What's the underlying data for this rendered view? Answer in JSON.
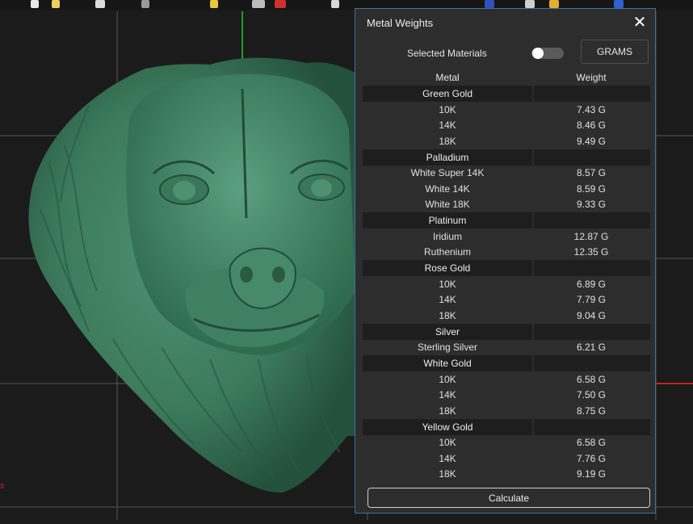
{
  "panel": {
    "title": "Metal Weights",
    "selected_materials_label": "Selected Materials",
    "units_button": "GRAMS",
    "calculate_button": "Calculate",
    "columns": [
      "Metal",
      "Weight"
    ],
    "groups": [
      {
        "name": "Green Gold",
        "items": [
          {
            "metal": "10K",
            "weight": "7.43 G"
          },
          {
            "metal": "14K",
            "weight": "8.46 G"
          },
          {
            "metal": "18K",
            "weight": "9.49 G"
          }
        ]
      },
      {
        "name": "Palladium",
        "items": [
          {
            "metal": "White Super 14K",
            "weight": "8.57 G"
          },
          {
            "metal": "White 14K",
            "weight": "8.59 G"
          },
          {
            "metal": "White 18K",
            "weight": "9.33 G"
          }
        ]
      },
      {
        "name": "Platinum",
        "items": [
          {
            "metal": "Iridium",
            "weight": "12.87 G"
          },
          {
            "metal": "Ruthenium",
            "weight": "12.35 G"
          }
        ]
      },
      {
        "name": "Rose Gold",
        "items": [
          {
            "metal": "10K",
            "weight": "6.89 G"
          },
          {
            "metal": "14K",
            "weight": "7.79 G"
          },
          {
            "metal": "18K",
            "weight": "9.04 G"
          }
        ]
      },
      {
        "name": "Silver",
        "items": [
          {
            "metal": "Sterling Silver",
            "weight": "6.21 G"
          }
        ]
      },
      {
        "name": "White Gold",
        "items": [
          {
            "metal": "10K",
            "weight": "6.58 G"
          },
          {
            "metal": "14K",
            "weight": "7.50 G"
          },
          {
            "metal": "18K",
            "weight": "8.75 G"
          }
        ]
      },
      {
        "name": "Yellow Gold",
        "items": [
          {
            "metal": "10K",
            "weight": "6.58 G"
          },
          {
            "metal": "14K",
            "weight": "7.76 G"
          },
          {
            "metal": "18K",
            "weight": "9.19 G"
          }
        ]
      }
    ]
  },
  "viewport": {
    "axis_label": "x",
    "model_color": "#3f7d5f",
    "grid_color": "#5a5a5a",
    "axis_green": "#1f9a2f",
    "axis_red": "#c62020"
  },
  "icons": {
    "close": "close-icon",
    "toggle": "toggle-switch"
  }
}
